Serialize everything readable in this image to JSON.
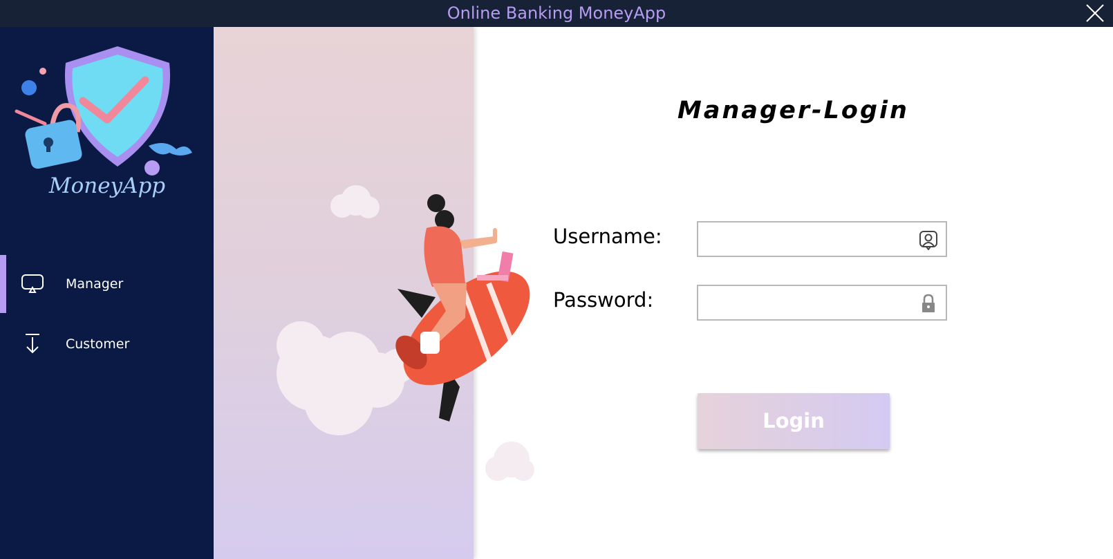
{
  "window": {
    "title": "Online Banking MoneyApp",
    "title_color": "#b69cf3",
    "titlebar_color": "#172236"
  },
  "sidebar": {
    "background": "#0a1a45",
    "logo": {
      "text": "MoneyApp",
      "icon": "shield-check-lock-logo"
    },
    "items": [
      {
        "label": "Manager",
        "icon": "monitor-icon",
        "active": true
      },
      {
        "label": "Customer",
        "icon": "download-arrow-icon",
        "active": false
      }
    ],
    "accent": "#b69cf3"
  },
  "main": {
    "heading": "Manager-Login",
    "username": {
      "label": "Username:",
      "value": "",
      "icon": "user-badge-icon"
    },
    "password": {
      "label": "Password:",
      "value": "",
      "icon": "lock-icon"
    },
    "login_button": {
      "label": "Login"
    }
  }
}
